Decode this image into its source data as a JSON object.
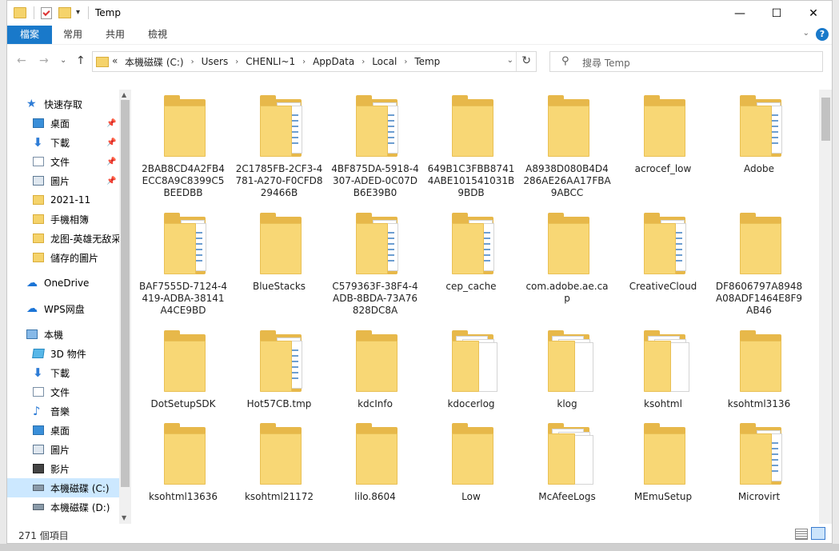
{
  "window": {
    "title": "Temp"
  },
  "titlebar": {
    "dropdown_glyph": "▾",
    "minimize_glyph": "—",
    "maximize_glyph": "☐",
    "close_glyph": "✕"
  },
  "ribbon": {
    "tabs": [
      {
        "label": "檔案"
      },
      {
        "label": "常用"
      },
      {
        "label": "共用"
      },
      {
        "label": "檢視"
      }
    ],
    "collapse_glyph": "⌄",
    "help_label": "?"
  },
  "nav": {
    "back_glyph": "←",
    "forward_glyph": "→",
    "recent_glyph": "⌄",
    "up_glyph": "↑",
    "overflow_glyph": "«",
    "breadcrumbs": [
      "本機磁碟 (C:)",
      "Users",
      "CHENLI~1",
      "AppData",
      "Local",
      "Temp"
    ],
    "crumb_separator": "›",
    "address_drop_glyph": "⌄",
    "refresh_glyph": "↻"
  },
  "search": {
    "icon_glyph": "⚲",
    "placeholder": "搜尋 Temp"
  },
  "navpane": {
    "pin_glyph": "📌",
    "items": [
      {
        "label": "快速存取",
        "icon": "star-icon"
      },
      {
        "label": "桌面",
        "icon": "desktop-icon",
        "pinned": true
      },
      {
        "label": "下載",
        "icon": "download-icon",
        "pinned": true
      },
      {
        "label": "文件",
        "icon": "document-icon",
        "pinned": true
      },
      {
        "label": "圖片",
        "icon": "picture-icon",
        "pinned": true
      },
      {
        "label": "2021-11",
        "icon": "folder-icon"
      },
      {
        "label": "手機相簿",
        "icon": "folder-icon"
      },
      {
        "label": "龙图-英雄无敌采",
        "icon": "folder-icon"
      },
      {
        "label": "儲存的圖片",
        "icon": "folder-icon"
      },
      {
        "label": "OneDrive",
        "icon": "cloud-icon"
      },
      {
        "label": "WPS网盘",
        "icon": "cloud-icon"
      },
      {
        "label": "本機",
        "icon": "computer-icon"
      },
      {
        "label": "3D 物件",
        "icon": "cube-icon"
      },
      {
        "label": "下載",
        "icon": "download-icon"
      },
      {
        "label": "文件",
        "icon": "document-icon"
      },
      {
        "label": "音樂",
        "icon": "music-icon"
      },
      {
        "label": "桌面",
        "icon": "desktop-icon"
      },
      {
        "label": "圖片",
        "icon": "picture-icon"
      },
      {
        "label": "影片",
        "icon": "video-icon"
      },
      {
        "label": "本機磁碟 (C:)",
        "icon": "drive-icon",
        "selected": true
      },
      {
        "label": "本機磁碟 (D:)",
        "icon": "drive-icon"
      }
    ],
    "scroll_up_glyph": "▲",
    "scroll_down_glyph": "▼"
  },
  "files": [
    {
      "name": "2BAB8CD4A2FB4ECC8A9C8399C5BEEDBB",
      "papers": false
    },
    {
      "name": "2C1785FB-2CF3-4781-A270-F0CFD829466B",
      "papers": true
    },
    {
      "name": "4BF875DA-5918-4307-ADED-0C07DB6E39B0",
      "papers": true
    },
    {
      "name": "649B1C3FBB87414ABE101541031B9BDB",
      "papers": false
    },
    {
      "name": "A8938D080B4D4286AE26AA17FBA9ABCC",
      "papers": false
    },
    {
      "name": "acrocef_low",
      "papers": false
    },
    {
      "name": "Adobe",
      "papers": true
    },
    {
      "name": "BAF7555D-7124-4419-ADBA-38141A4CE9BD",
      "papers": true
    },
    {
      "name": "BlueStacks",
      "papers": false
    },
    {
      "name": "C579363F-38F4-4ADB-8BDA-73A76828DC8A",
      "papers": true
    },
    {
      "name": "cep_cache",
      "papers": true
    },
    {
      "name": "com.adobe.ae.cap",
      "papers": false
    },
    {
      "name": "CreativeCloud",
      "papers": true
    },
    {
      "name": "DF8606797A8948A08ADF1464E8F9AB46",
      "papers": false
    },
    {
      "name": "DotSetupSDK",
      "papers": false
    },
    {
      "name": "Hot57CB.tmp",
      "papers": true
    },
    {
      "name": "kdcInfo",
      "papers": false
    },
    {
      "name": "kdocerlog",
      "papers": "white"
    },
    {
      "name": "klog",
      "papers": "white"
    },
    {
      "name": "ksohtml",
      "papers": "white"
    },
    {
      "name": "ksohtml3136",
      "papers": false
    },
    {
      "name": "ksohtml13636",
      "papers": false
    },
    {
      "name": "ksohtml21172",
      "papers": false
    },
    {
      "name": "lilo.8604",
      "papers": false
    },
    {
      "name": "Low",
      "papers": false
    },
    {
      "name": "McAfeeLogs",
      "papers": "white"
    },
    {
      "name": "MEmuSetup",
      "papers": false
    },
    {
      "name": "Microvirt",
      "papers": true
    }
  ],
  "status": {
    "item_count": "271 個項目"
  },
  "colors": {
    "file_tab": "#1979ca",
    "selection": "#cce8ff",
    "folder": "#f8d775"
  }
}
